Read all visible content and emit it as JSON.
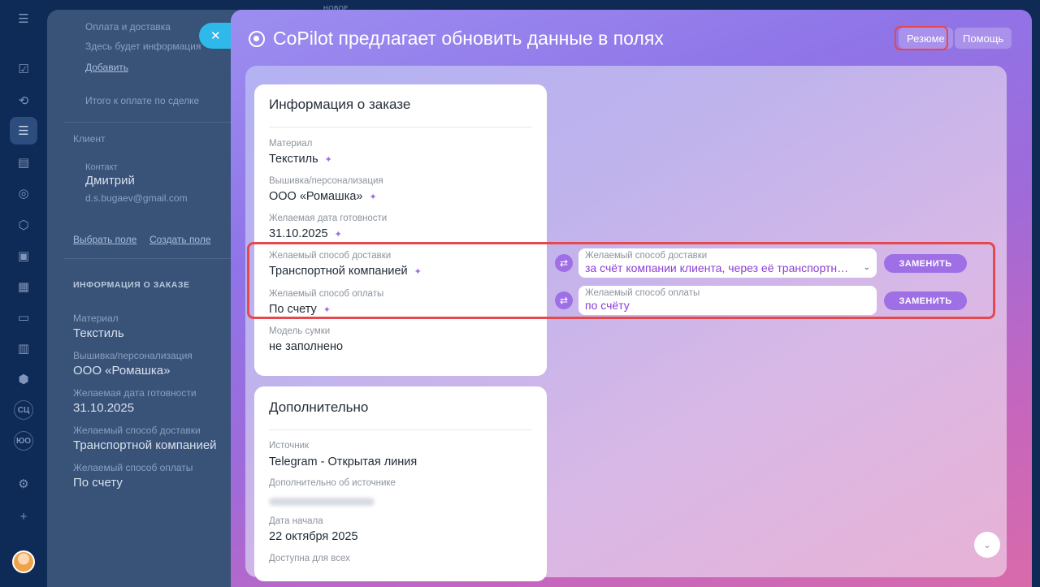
{
  "sidebar": {
    "icons": [
      "menu-icon",
      "tasks-icon",
      "flows-icon",
      "crm-icon",
      "contact-card-icon",
      "robot-icon",
      "box-icon",
      "sites-icon",
      "calendar-icon",
      "shop-icon",
      "analytics-icon",
      "hexagon-icon",
      "sc-icon",
      "io-icon",
      "settings-icon",
      "plus-icon"
    ],
    "sc_label": "СЦ",
    "io_label": "ЮО"
  },
  "background_card": {
    "new_badge": "НОВОЕ",
    "payment_delivery_label": "Оплата и доставка",
    "payment_delivery_placeholder": "Здесь будет информация",
    "add_link": "Добавить",
    "total_label": "Итого к оплате по сделке",
    "client_label": "Клиент",
    "contact_label": "Контакт",
    "contact_name": "Дмитрий",
    "contact_email": "d.s.bugaev@gmail.com",
    "choose_field": "Выбрать поле",
    "create_field": "Создать поле",
    "section_title": "ИНФОРМАЦИЯ О ЗАКАЗЕ",
    "fields": [
      {
        "label": "Материал",
        "value": "Текстиль"
      },
      {
        "label": "Вышивка/персонализация",
        "value": "ООО «Ромашка»"
      },
      {
        "label": "Желаемая дата готовности",
        "value": "31.10.2025"
      },
      {
        "label": "Желаемый способ доставки",
        "value": "Транспортной компанией"
      },
      {
        "label": "Желаемый способ оплаты",
        "value": "По счету"
      }
    ]
  },
  "slider": {
    "title": "CoPilot предлагает обновить данные в полях",
    "resume_button": "Резюме",
    "help_button": "Помощь"
  },
  "order_card": {
    "title": "Информация о заказе",
    "fields": [
      {
        "label": "Материал",
        "value": "Текстиль"
      },
      {
        "label": "Вышивка/персонализация",
        "value": "ООО «Ромашка»"
      },
      {
        "label": "Желаемая дата готовности",
        "value": "31.10.2025"
      },
      {
        "label": "Желаемый способ доставки",
        "value": "Транспортной компанией"
      },
      {
        "label": "Желаемый способ оплаты",
        "value": "По счету"
      },
      {
        "label": "Модель сумки",
        "value": "не заполнено"
      }
    ]
  },
  "extra_card": {
    "title": "Дополнительно",
    "fields": [
      {
        "label": "Источник",
        "value": "Telegram - Открытая линия"
      },
      {
        "label": "Дополнительно об источнике",
        "value": ""
      },
      {
        "label": "Дата начала",
        "value": "22 октября 2025"
      },
      {
        "label": "Доступна для всех",
        "value": ""
      }
    ]
  },
  "suggestions": [
    {
      "label": "Желаемый способ доставки",
      "value": "за счёт компании клиента, через её транспортную компанию",
      "button": "ЗАМЕНИТЬ"
    },
    {
      "label": "Желаемый способ оплаты",
      "value": "по счёту",
      "button": "ЗАМЕНИТЬ"
    }
  ],
  "colors": {
    "accent_purple": "#9f6fe6",
    "highlight_red": "#e5484d",
    "suggestion_text": "#8c3ed4"
  }
}
